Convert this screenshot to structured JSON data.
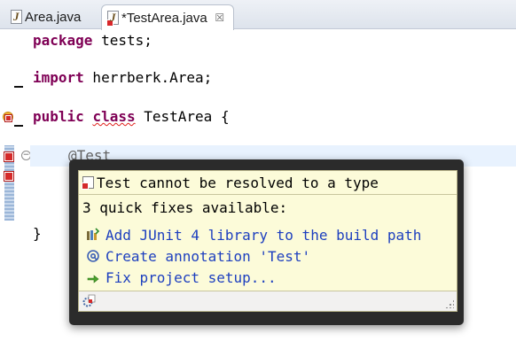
{
  "tabs": [
    {
      "label": "Area.java",
      "active": false,
      "icon": "java-file-icon"
    },
    {
      "label": "*TestArea.java",
      "active": true,
      "icon": "java-file-error-icon",
      "close_glyph": "☒"
    }
  ],
  "code": {
    "line1": {
      "keyword": "package",
      "rest": " tests;"
    },
    "line2": {
      "keyword": "import",
      "rest": " herrberk.Area;"
    },
    "line3": {
      "keyword_public": "public",
      "keyword_class": "class",
      "rest": " TestArea {"
    },
    "line4": {
      "annotation": "@Test"
    },
    "line5": {
      "text": "}"
    }
  },
  "quick_fix": {
    "problem": "Test cannot be resolved to a type",
    "count_text": "3 quick fixes available:",
    "fixes": [
      {
        "label": "Add JUnit 4 library to the build path",
        "icon": "library-add-icon"
      },
      {
        "label": "Create annotation 'Test'",
        "icon": "annotation-icon"
      },
      {
        "label": "Fix project setup...",
        "icon": "arrow-icon"
      }
    ]
  },
  "colors": {
    "keyword": "#7f0055",
    "link": "#1d3fbf",
    "popup_bg": "#fcfbd9",
    "current_line": "#e8f2fe",
    "error": "#d42a2a"
  }
}
